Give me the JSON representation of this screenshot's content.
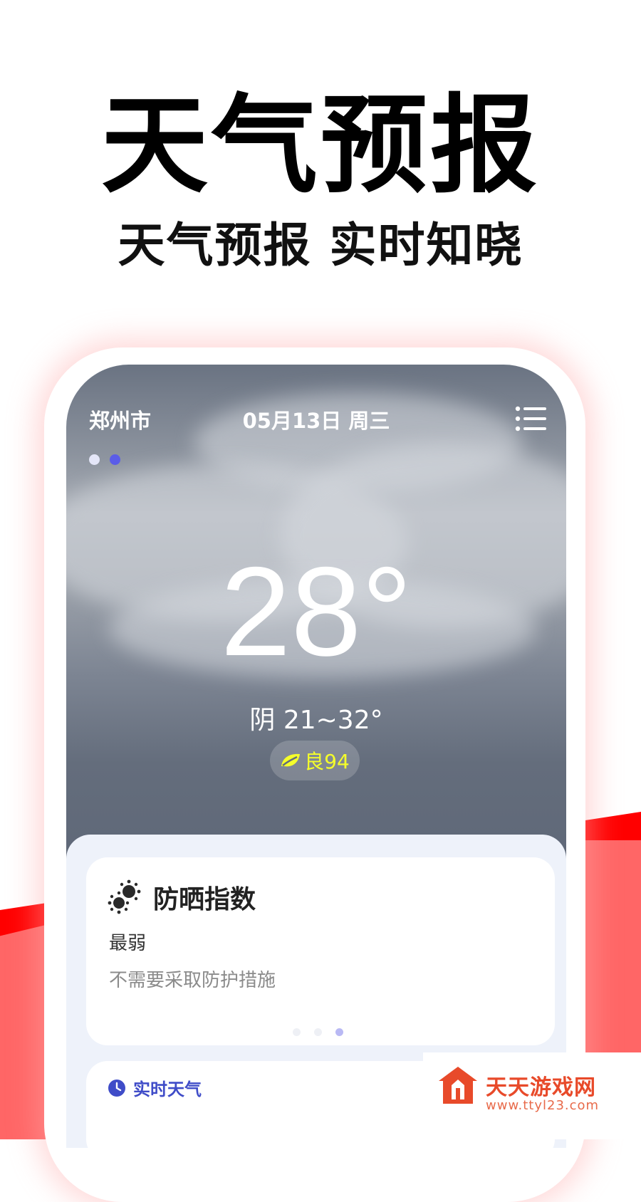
{
  "promo": {
    "title": "天气预报",
    "subtitle": "天气预报 实时知晓"
  },
  "weather": {
    "city": "郑州市",
    "date": "05月13日 周三",
    "temperature": "28°",
    "condition_range": "阴 21~32°",
    "aqi_label": "良94",
    "page_indicator": {
      "count": 2,
      "active": 2
    }
  },
  "sunscreen_card": {
    "title": "防晒指数",
    "level": "最弱",
    "description": "不需要采取防护措施",
    "carousel": {
      "count": 3,
      "active": 3
    }
  },
  "realtime_card": {
    "title": "实时天气"
  },
  "watermark": {
    "name": "天天游戏网",
    "url": "www.ttyl23.com"
  },
  "colors": {
    "brand_red": "#ff0000",
    "aqi_text": "#f5ff2a",
    "accent_blue": "#3f4cc8",
    "sky_gray": "#646d7c"
  }
}
